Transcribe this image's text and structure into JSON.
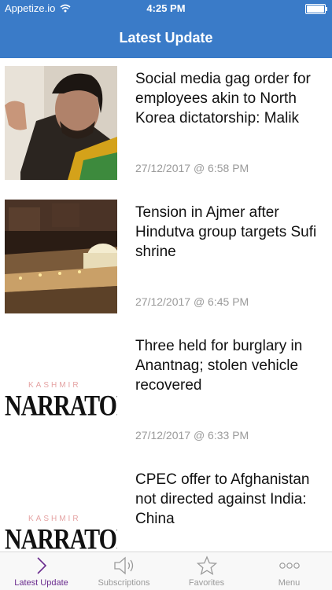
{
  "status_bar": {
    "carrier": "Appetize.io",
    "time": "4:25 PM"
  },
  "header": {
    "title": "Latest Update"
  },
  "articles": [
    {
      "title": "Social media gag order for employees akin to North Korea dictatorship: Malik",
      "date": "27/12/2017 @ 6:58 PM",
      "thumb": "person-photo"
    },
    {
      "title": "Tension in Ajmer after Hindutva group targets Sufi shrine",
      "date": "27/12/2017 @ 6:45 PM",
      "thumb": "shrine-photo"
    },
    {
      "title": "Three held for burglary in Anantnag; stolen vehicle recovered",
      "date": "27/12/2017 @ 6:33 PM",
      "thumb": "kashmir-narrator-logo"
    },
    {
      "title": "CPEC offer to Afghanistan not directed against India: China",
      "date": "",
      "thumb": "kashmir-narrator-logo"
    }
  ],
  "logo": {
    "kashmir": "KASHMIR",
    "word": "NARRATOR"
  },
  "tabs": [
    {
      "label": "Latest Update",
      "icon": "chevron-right-icon",
      "active": true
    },
    {
      "label": "Subscriptions",
      "icon": "speaker-icon",
      "active": false
    },
    {
      "label": "Favorites",
      "icon": "star-icon",
      "active": false
    },
    {
      "label": "Menu",
      "icon": "more-dots-icon",
      "active": false
    }
  ],
  "colors": {
    "bar": "#3a7bc8",
    "active_tab": "#6a2c8e",
    "inactive_tab": "#9a9a9a",
    "date": "#9a9a9a"
  }
}
